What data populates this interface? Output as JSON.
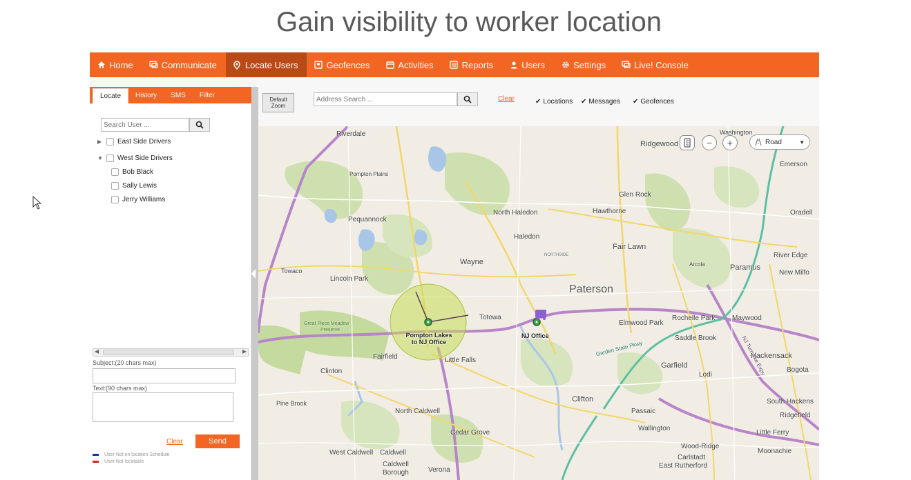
{
  "slide": {
    "title": "Gain visibility to worker location"
  },
  "nav": {
    "items": [
      {
        "label": "Home",
        "icon": "home-icon"
      },
      {
        "label": "Communicate",
        "icon": "chat-icon"
      },
      {
        "label": "Locate Users",
        "icon": "pin-icon",
        "active": true
      },
      {
        "label": "Geofences",
        "icon": "geofence-icon"
      },
      {
        "label": "Activities",
        "icon": "calendar-icon"
      },
      {
        "label": "Reports",
        "icon": "report-icon"
      },
      {
        "label": "Users",
        "icon": "user-icon"
      },
      {
        "label": "Settings",
        "icon": "gear-icon"
      },
      {
        "label": "Live! Console",
        "icon": "console-icon"
      }
    ]
  },
  "left": {
    "tabs": [
      "Locate",
      "History",
      "SMS",
      "Filter"
    ],
    "search_placeholder": "Search User ...",
    "groups": [
      {
        "label": "East Side Drivers",
        "expanded": false
      },
      {
        "label": "West Side Drivers",
        "expanded": true
      }
    ],
    "users": [
      "Bob Black",
      "Sally Lewis",
      "Jerry Williams"
    ],
    "subject_label": "Subject:(20 chars max)",
    "text_label": "Text:(90 chars max)",
    "clear_label": "Clear",
    "send_label": "Send",
    "legend": [
      {
        "label": "User Not on location Schedule",
        "color": "#1a2bd6"
      },
      {
        "label": "User Not locatable",
        "color": "#e0201b"
      }
    ]
  },
  "map_toolbar": {
    "default_zoom_line1": "Default",
    "default_zoom_line2": "Zoom",
    "address_placeholder": "Address Search ...",
    "clear_label": "Clear",
    "toggles": [
      "Locations",
      "Messages",
      "Geofences"
    ]
  },
  "map": {
    "road_label": "Road",
    "places": {
      "riverdale": "Riverdale",
      "ridgewood": "Ridgewood",
      "washington": "Washington",
      "emerson": "Emerson",
      "pompton_plains": "Pompton Plains",
      "glen_rock": "Glen Rock",
      "oradell": "Oradell",
      "north_haledon": "North Haledon",
      "hawthorne": "Hawthorne",
      "pequannock": "Pequannock",
      "haledon": "Haledon",
      "fair_lawn": "Fair Lawn",
      "wayne": "Wayne",
      "paramus": "Paramus",
      "river_edge": "River Edge",
      "new_milford": "New Milfo",
      "towaco": "Towaco",
      "lincoln_park": "Lincoln Park",
      "paterson": "Paterson",
      "totowa": "Totowa",
      "elmwood_park": "Elmwood Park",
      "rochelle_park": "Rochelle Park",
      "maywood": "Maywood",
      "saddle_brook": "Saddle Brook",
      "fairfield": "Fairfield",
      "little_falls": "Little Falls",
      "garfield": "Garfield",
      "hackensack": "Hackensack",
      "clinton": "Clinton",
      "lodi": "Lodi",
      "bogota": "Bogota",
      "pine_brook": "Pine Brook",
      "clifton": "Clifton",
      "south_hackensack": "South Hackens",
      "north_caldwell": "North Caldwell",
      "passaic": "Passaic",
      "ridgefield": "Ridgefield",
      "wallington": "Wallington",
      "cedar_grove": "Cedar Grove",
      "little_ferry": "Little Ferry",
      "west_caldwell": "West Caldwell",
      "caldwell": "Caldwell",
      "wood_ridge": "Wood-Ridge",
      "moonachie": "Moonachie",
      "carlstadt": "Carlstadt",
      "caldwell_borough_1": "Caldwell",
      "caldwell_borough_2": "Borough",
      "verona": "Verona",
      "east_rutherford": "East Rutherford",
      "arcola": "Arcola",
      "great_piece_1": "Great Piece Meadow",
      "great_piece_2": "Preserve",
      "northside": "NORTHSIDE",
      "garden_state": "Garden State Pkwy",
      "nj_turnpike": "NJ Turnpike Expy"
    },
    "geofence_label_line1": "Pompton Lakes",
    "geofence_label_line2": "to NJ Office",
    "office_label": "NJ Office"
  }
}
